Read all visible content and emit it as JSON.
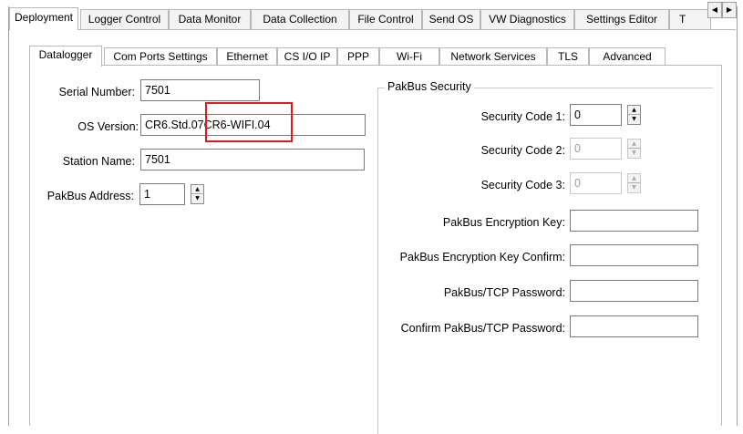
{
  "top_tabs": [
    {
      "label": "Deployment",
      "active": true
    },
    {
      "label": "Logger Control",
      "active": false
    },
    {
      "label": "Data Monitor",
      "active": false
    },
    {
      "label": "Data Collection",
      "active": false
    },
    {
      "label": "File Control",
      "active": false
    },
    {
      "label": "Send OS",
      "active": false
    },
    {
      "label": "VW Diagnostics",
      "active": false
    },
    {
      "label": "Settings Editor",
      "active": false
    },
    {
      "label": "T",
      "active": false
    }
  ],
  "sub_tabs": [
    {
      "label": "Datalogger",
      "active": true
    },
    {
      "label": "Com Ports Settings",
      "active": false
    },
    {
      "label": "Ethernet",
      "active": false
    },
    {
      "label": "CS I/O IP",
      "active": false
    },
    {
      "label": "PPP",
      "active": false
    },
    {
      "label": "Wi-Fi",
      "active": false
    },
    {
      "label": "Network Services",
      "active": false
    },
    {
      "label": "TLS",
      "active": false
    },
    {
      "label": "Advanced",
      "active": false
    }
  ],
  "datalogger": {
    "serial_number_label": "Serial Number:",
    "serial_number_value": "7501",
    "os_version_label": "OS Version:",
    "os_version_value_part1": "CR6.Std.07",
    "os_version_value_part2": "CR6-WIFI.04",
    "station_name_label": "Station Name:",
    "station_name_value": "7501",
    "pakbus_address_label": "PakBus Address:",
    "pakbus_address_value": "1"
  },
  "pakbus_security": {
    "group_title": "PakBus Security",
    "security_code_1_label": "Security Code 1:",
    "security_code_1_value": "0",
    "security_code_2_label": "Security Code 2:",
    "security_code_2_value": "0",
    "security_code_3_label": "Security Code 3:",
    "security_code_3_value": "0",
    "encryption_key_label": "PakBus Encryption Key:",
    "encryption_key_value": "",
    "encryption_key_confirm_label": "PakBus Encryption Key Confirm:",
    "encryption_key_confirm_value": "",
    "tcp_password_label": "PakBus/TCP Password:",
    "tcp_password_value": "",
    "confirm_tcp_password_label": "Confirm PakBus/TCP Password:",
    "confirm_tcp_password_value": ""
  },
  "icons": {
    "scroll_left": "triangle-left-icon",
    "scroll_right": "triangle-right-icon",
    "spin_up": "triangle-up-icon",
    "spin_down": "triangle-down-icon"
  },
  "colors": {
    "highlight": "#e01b1b",
    "border": "#b8b8b8",
    "disabled_text": "#9a9a9a"
  }
}
